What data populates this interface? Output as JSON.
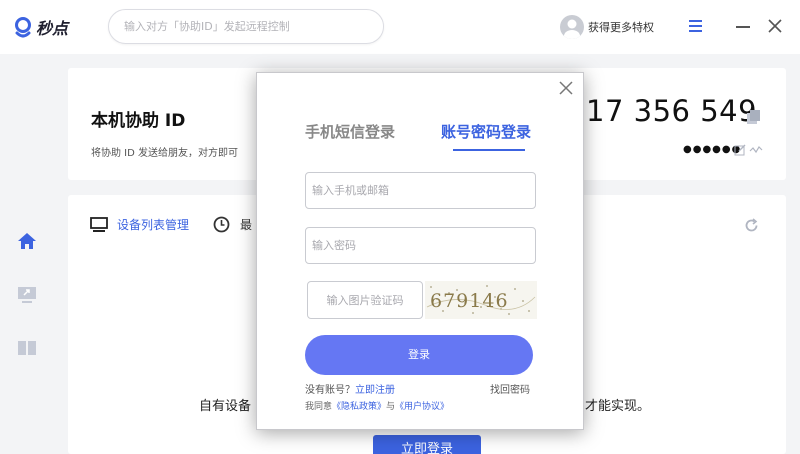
{
  "app": {
    "name": "秒点"
  },
  "colors": {
    "accent": "#3c63e0",
    "login_button": "#6577f3",
    "background": "#f3f4f6"
  },
  "titlebar": {
    "search_placeholder": "输入对方「协助ID」发起远程控制",
    "user_label": "获得更多特权",
    "icons": [
      "menu-icon",
      "minimize-icon",
      "close-icon"
    ]
  },
  "sidebar": {
    "items": [
      {
        "icon": "home-icon"
      },
      {
        "icon": "remote-desktop-icon"
      },
      {
        "icon": "book-icon"
      }
    ]
  },
  "id_card": {
    "title": "本机协助 ID",
    "description": "将协助 ID 发送给朋友，对方即可",
    "id_number": "17 356 549",
    "password_mask": "●●●●●●"
  },
  "main_card": {
    "tabs": [
      {
        "label": "设备列表管理",
        "icon": "monitor-icon"
      },
      {
        "label": "最",
        "icon": "clock-icon"
      }
    ],
    "message_left": "自有设备",
    "message_right": "才能实现。",
    "cta_label": "立即登录"
  },
  "login_modal": {
    "tab_sms": "手机短信登录",
    "tab_password": "账号密码登录",
    "active_tab": "账号密码登录",
    "phone_placeholder": "输入手机或邮箱",
    "password_placeholder": "输入密码",
    "captcha_placeholder": "输入图片验证码",
    "captcha_text": "679146",
    "login_label": "登录",
    "no_account": "没有账号？",
    "register": "立即注册",
    "forgot": "找回密码",
    "agree_prefix": "我同意",
    "privacy": "《隐私政策》",
    "agree_and": "与",
    "terms": "《用户协议》"
  }
}
